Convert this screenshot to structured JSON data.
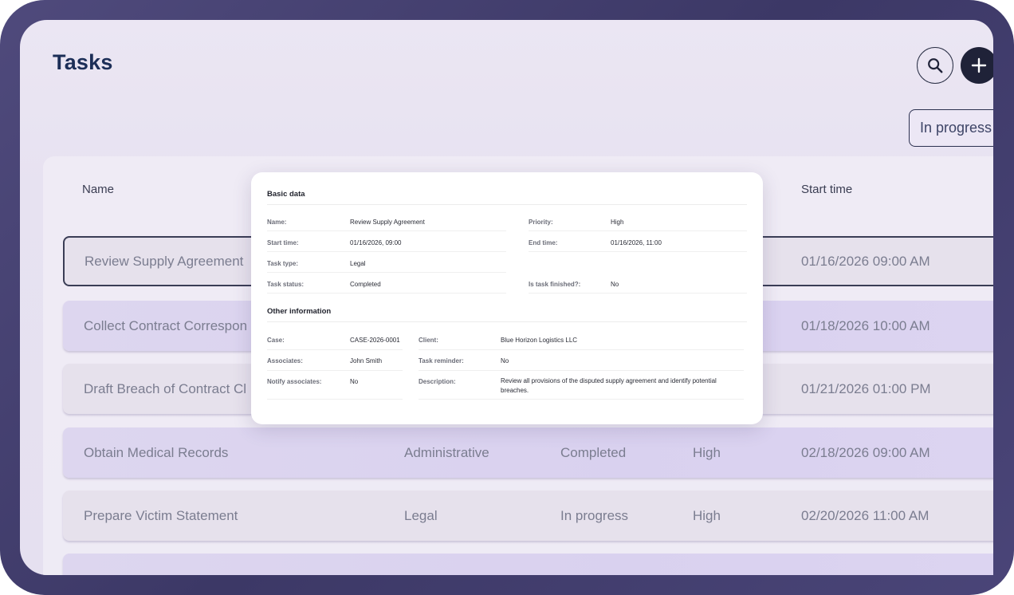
{
  "header": {
    "title": "Tasks",
    "search_icon": "search-icon",
    "add_icon": "plus-icon",
    "filter_label": "In progress"
  },
  "table": {
    "columns": [
      "Name",
      "Start time"
    ],
    "rows": [
      {
        "name": "Review Supply Agreement",
        "type": "",
        "status": "",
        "priority": "",
        "start": "01/16/2026 09:00 AM"
      },
      {
        "name": "Collect Contract Correspon",
        "type": "",
        "status": "",
        "priority": "",
        "start": "01/18/2026 10:00 AM"
      },
      {
        "name": "Draft Breach of Contract Cl",
        "type": "",
        "status": "",
        "priority": "",
        "start": "01/21/2026 01:00 PM"
      },
      {
        "name": "Obtain Medical Records",
        "type": "Administrative",
        "status": "Completed",
        "priority": "High",
        "start": "02/18/2026 09:00 AM"
      },
      {
        "name": "Prepare Victim Statement",
        "type": "Legal",
        "status": "In progress",
        "priority": "High",
        "start": "02/20/2026 11:00 AM"
      }
    ]
  },
  "popup": {
    "basic_title": "Basic data",
    "other_title": "Other information",
    "basic": {
      "name_label": "Name:",
      "name_value": "Review Supply Agreement",
      "priority_label": "Priority:",
      "priority_value": "High",
      "start_label": "Start time:",
      "start_value": "01/16/2026, 09:00",
      "end_label": "End time:",
      "end_value": "01/16/2026, 11:00",
      "type_label": "Task type:",
      "type_value": "Legal",
      "status_label": "Task status:",
      "status_value": "Completed",
      "finished_label": "Is task finished?:",
      "finished_value": "No"
    },
    "other": {
      "case_label": "Case:",
      "case_value": "CASE-2026-0001",
      "client_label": "Client:",
      "client_value": "Blue Horizon Logistics LLC",
      "associates_label": "Associates:",
      "associates_value": "John Smith",
      "reminder_label": "Task reminder:",
      "reminder_value": "No",
      "notify_label": "Notify associates:",
      "notify_value": "No",
      "description_label": "Description:",
      "description_value": "Review all provisions of the disputed supply agreement and identify potential breaches."
    }
  }
}
